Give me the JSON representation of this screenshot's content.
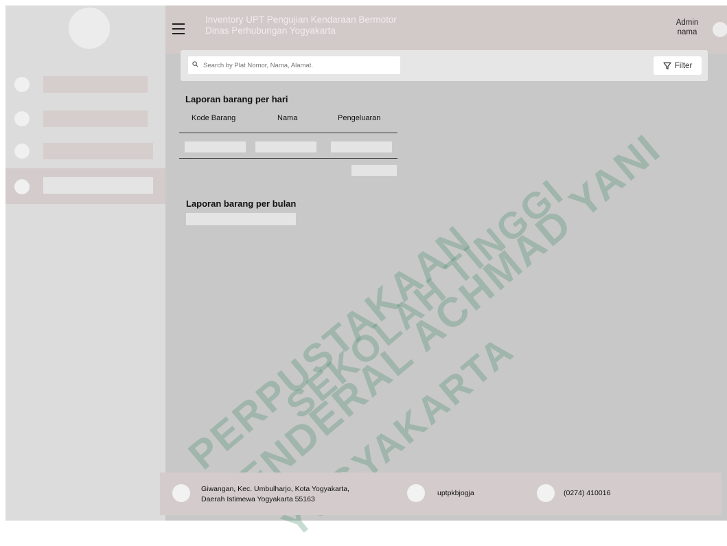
{
  "header": {
    "title_line1": "Inventory UPT Pengujian Kendaraan Bermotor",
    "title_line2": "Dinas Perhubungan Yogyakarta",
    "user_role": "Admin",
    "user_name": "nama",
    "menu_icon": "hamburger-icon"
  },
  "sidebar": {
    "items": [
      {
        "label": "",
        "active": false
      },
      {
        "label": "",
        "active": false
      },
      {
        "label": "",
        "active": false
      },
      {
        "label": "",
        "active": true
      }
    ]
  },
  "search": {
    "placeholder": "Search by Plat Nomor, Nama, Alamat.",
    "value": "",
    "icon": "search-icon"
  },
  "filter": {
    "label": "Filter",
    "icon": "filter-icon"
  },
  "daily_report": {
    "title": "Laporan barang per hari",
    "columns": [
      "Kode Barang",
      "Nama",
      "Pengeluaran"
    ]
  },
  "monthly_report": {
    "title": "Laporan barang per bulan"
  },
  "watermark": {
    "line1": "PERPUSTAKAAN",
    "line2": "SEKOLAH TINGGI",
    "line3": "JENDERAL ACHMAD YANI",
    "line4": "YOGYAKARTA"
  },
  "footer": {
    "address_line1": "Giwangan, Kec. Umbulharjo, Kota Yogyakarta,",
    "address_line2": "Daerah Istimewa Yogyakarta 55163",
    "social": "uptpkbjogja",
    "phone": "(0274) 410016"
  },
  "colors": {
    "header_bg": "#d2c9c9",
    "sidebar_bg": "#dcdcdc",
    "content_bg": "#c8c8c8",
    "watermark": "#468c6e"
  }
}
